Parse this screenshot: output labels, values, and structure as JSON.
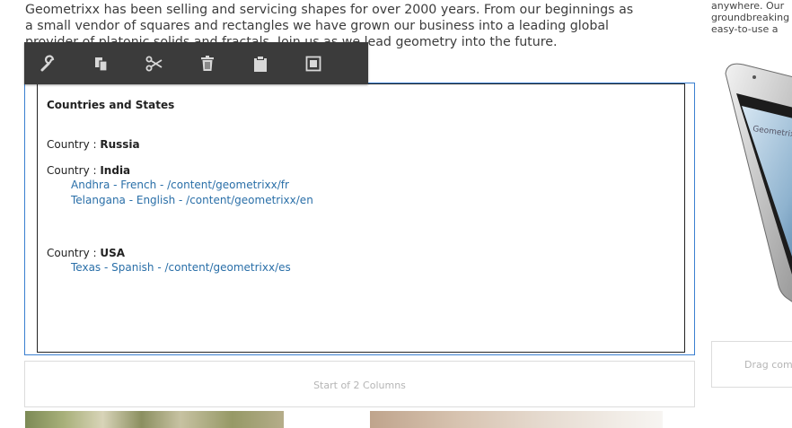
{
  "intro": {
    "line1": "Geometrixx has been selling and servicing shapes for over 2000 years. From our beginnings as",
    "line2": "a small vendor of squares and rectangles we have grown our business into a leading global",
    "line3": "provider of platonic solids and fractals. Join us as we lead geometry into the future."
  },
  "right_column": {
    "lines": [
      "anywhere. Our",
      "groundbreaking",
      "easy-to-use a"
    ],
    "phone_screen_text": "Geometrixx",
    "drag_placeholder": "Drag components here"
  },
  "toolbar": {
    "icons": [
      "wrench-icon",
      "copy-icon",
      "cut-icon",
      "delete-icon",
      "paste-icon",
      "insert-icon"
    ]
  },
  "component": {
    "title": "Countries and States",
    "country_label": "Country : ",
    "countries": [
      {
        "name": "Russia",
        "states": []
      },
      {
        "name": "India",
        "states": [
          "Andhra - French - /content/geometrixx/fr",
          "Telangana - English - /content/geometrixx/en"
        ]
      },
      {
        "name": "USA",
        "states": [
          "Texas - Spanish - /content/geometrixx/es"
        ]
      }
    ]
  },
  "columns_placeholder": "Start of 2 Columns",
  "colors": {
    "accent_blue": "#3a7fd0",
    "link_blue": "#2a6fa8",
    "toolbar_bg": "#3b3b3b"
  }
}
